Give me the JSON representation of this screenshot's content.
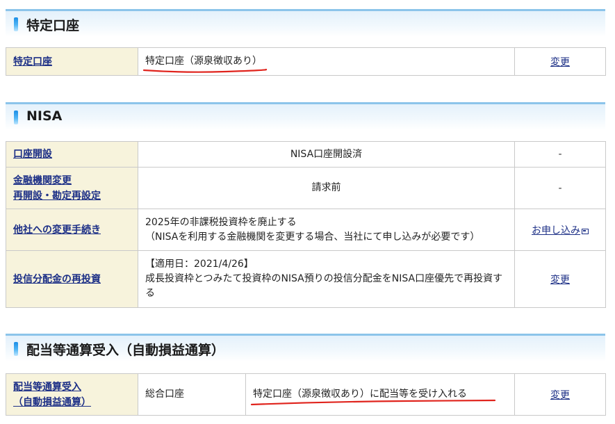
{
  "sections": {
    "tokutei": {
      "title": "特定口座",
      "row": {
        "label": "特定口座",
        "value": "特定口座（源泉徴収あり）",
        "action": "変更"
      }
    },
    "nisa": {
      "title": "NISA",
      "rows": [
        {
          "label": "口座開設",
          "value": "NISA口座開設済",
          "action": "-"
        },
        {
          "label_line1": "金融機関変更",
          "label_line2": "再開設・勘定再設定",
          "value": "請求前",
          "action": "-"
        },
        {
          "label": "他社への変更手続き",
          "value_line1": "2025年の非課税投資枠を廃止する",
          "value_line2": "（NISAを利用する金融機関を変更する場合、当社にて申し込みが必要です）",
          "action": "お申し込み"
        },
        {
          "label": "投信分配金の再投資",
          "value_line1": "【適用日：2021/4/26】",
          "value_line2": "成長投資枠とつみたて投資枠のNISA預りの投信分配金をNISA口座優先で再投資する",
          "action": "変更"
        }
      ]
    },
    "haito": {
      "title": "配当等通算受入（自動損益通算）",
      "row": {
        "label_line1": "配当等通算受入",
        "label_line2": "（自動損益通算）",
        "value_sub": "総合口座",
        "value_main": "特定口座（源泉徴収あり）に配当等を受け入れる",
        "action": "変更"
      }
    }
  },
  "colors": {
    "header_border": "#8cc4ea",
    "label_bg": "#f7f3dc",
    "link": "#1c2f86",
    "annotation_underline": "#e0241d"
  },
  "icons": {
    "section_bar": "section-marker-icon",
    "external": "external-window-icon"
  }
}
